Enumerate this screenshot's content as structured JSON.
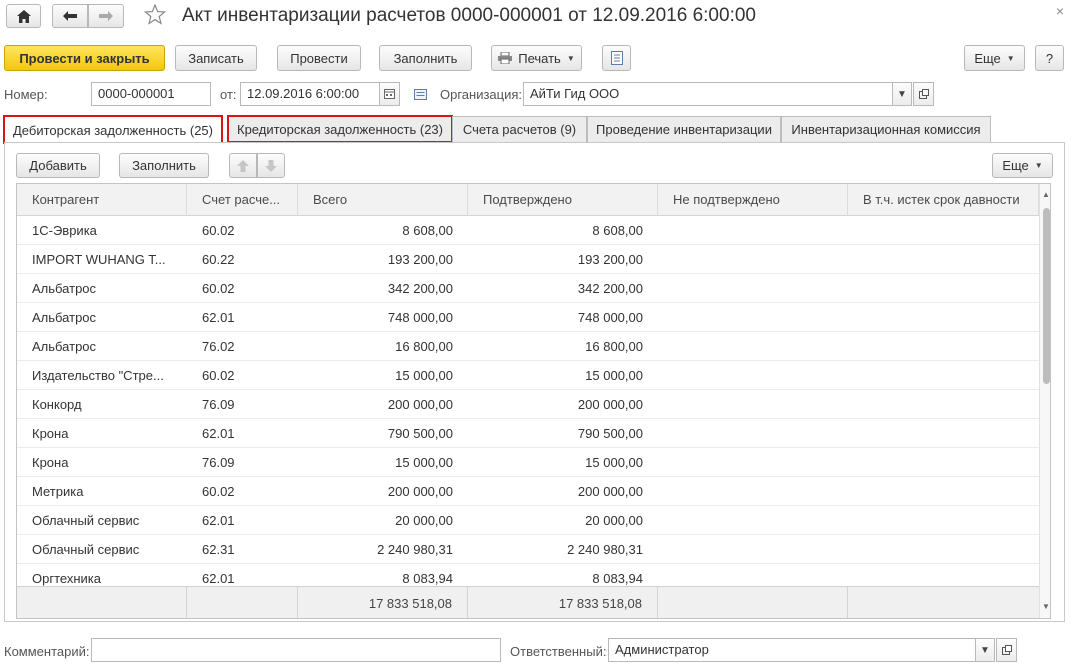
{
  "window": {
    "title": "Акт инвентаризации расчетов 0000-000001 от 12.09.2016 6:00:00",
    "close": "×"
  },
  "toolbar": {
    "post_close": "Провести и закрыть",
    "save": "Записать",
    "post": "Провести",
    "fill": "Заполнить",
    "print": "Печать",
    "more": "Еще",
    "help": "?"
  },
  "header": {
    "number_label": "Номер:",
    "number_value": "0000-000001",
    "date_label": "от:",
    "date_value": "12.09.2016  6:00:00",
    "org_label": "Организация:",
    "org_value": "АйТи Гид ООО"
  },
  "tabs": [
    {
      "label": "Дебиторская задолженность (25)"
    },
    {
      "label": "Кредиторская задолженность (23)"
    },
    {
      "label": "Счета расчетов (9)"
    },
    {
      "label": "Проведение инвентаризации"
    },
    {
      "label": "Инвентаризационная комиссия"
    }
  ],
  "table_toolbar": {
    "add": "Добавить",
    "fill": "Заполнить",
    "more": "Еще"
  },
  "table": {
    "columns": [
      "Контрагент",
      "Счет расче...",
      "Всего",
      "Подтверждено",
      "Не подтверждено",
      "В т.ч. истек срок давности"
    ],
    "rows": [
      [
        "1С-Эврика",
        "60.02",
        "8 608,00",
        "8 608,00"
      ],
      [
        "IMPORT WUHANG T...",
        "60.22",
        "193 200,00",
        "193 200,00"
      ],
      [
        "Альбатрос",
        "60.02",
        "342 200,00",
        "342 200,00"
      ],
      [
        "Альбатрос",
        "62.01",
        "748 000,00",
        "748 000,00"
      ],
      [
        "Альбатрос",
        "76.02",
        "16 800,00",
        "16 800,00"
      ],
      [
        "Издательство \"Стре...",
        "60.02",
        "15 000,00",
        "15 000,00"
      ],
      [
        "Конкорд",
        "76.09",
        "200 000,00",
        "200 000,00"
      ],
      [
        "Крона",
        "62.01",
        "790 500,00",
        "790 500,00"
      ],
      [
        "Крона",
        "76.09",
        "15 000,00",
        "15 000,00"
      ],
      [
        "Метрика",
        "60.02",
        "200 000,00",
        "200 000,00"
      ],
      [
        "Облачный сервис",
        "62.01",
        "20 000,00",
        "20 000,00"
      ],
      [
        "Облачный сервис",
        "62.31",
        "2 240 980,31",
        "2 240 980,31"
      ],
      [
        "Оргтехника",
        "62.01",
        "8 083,94",
        "8 083,94"
      ]
    ],
    "totals": {
      "total": "17 833 518,08",
      "confirmed": "17 833 518,08"
    }
  },
  "footer": {
    "comment_label": "Комментарий:",
    "comment_value": "",
    "responsible_label": "Ответственный:",
    "responsible_value": "Администратор"
  },
  "colors": {
    "primary": "#f5c70a",
    "highlight": "#d9141b"
  }
}
